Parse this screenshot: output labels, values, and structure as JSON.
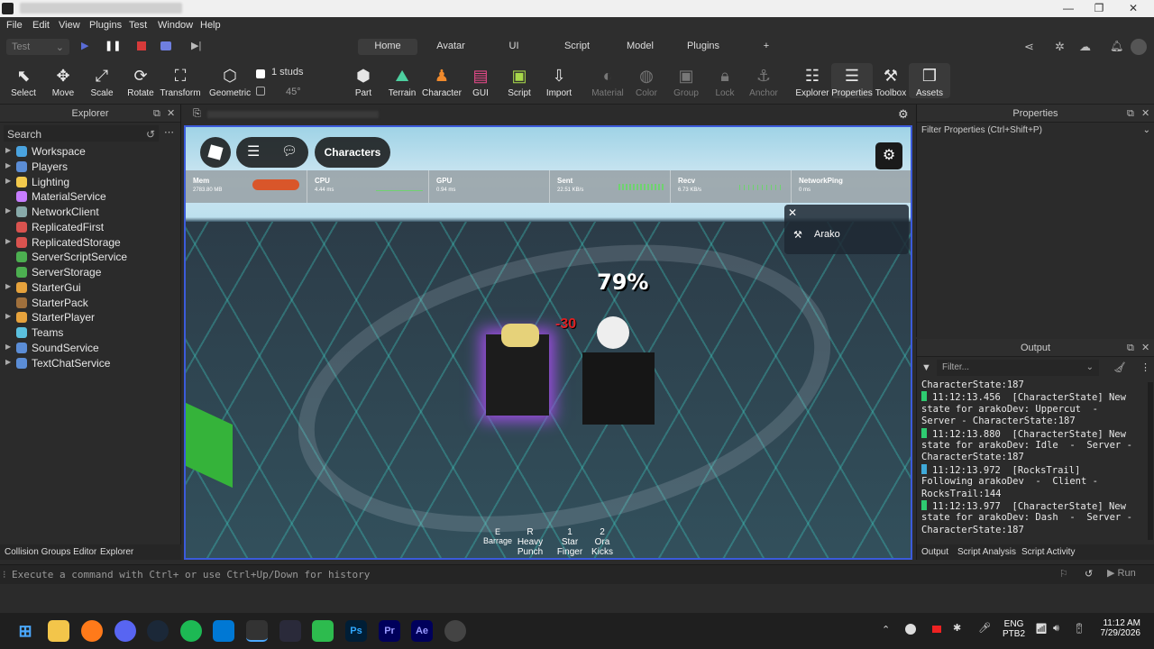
{
  "menu": [
    "File",
    "Edit",
    "View",
    "Plugins",
    "Test",
    "Window",
    "Help"
  ],
  "toolbar": {
    "mode": "Test",
    "ribbon_tabs": [
      "Home",
      "Avatar",
      "UI",
      "Script",
      "Model",
      "Plugins",
      "+"
    ],
    "studs": "1 studs",
    "angle": "45°"
  },
  "tools": [
    {
      "label": "Select",
      "icon": "cursor-icon"
    },
    {
      "label": "Move",
      "icon": "move-icon"
    },
    {
      "label": "Scale",
      "icon": "scale-icon"
    },
    {
      "label": "Rotate",
      "icon": "rotate-icon"
    },
    {
      "label": "Transform",
      "icon": "transform-icon"
    },
    {
      "label": "Geometric",
      "icon": "geometric-icon"
    },
    {
      "label": "Part",
      "icon": "part-icon"
    },
    {
      "label": "Terrain",
      "icon": "terrain-icon"
    },
    {
      "label": "Character",
      "icon": "character-icon"
    },
    {
      "label": "GUI",
      "icon": "gui-icon"
    },
    {
      "label": "Script",
      "icon": "script-icon"
    },
    {
      "label": "Import",
      "icon": "import-icon"
    },
    {
      "label": "Material",
      "icon": "material-icon"
    },
    {
      "label": "Color",
      "icon": "color-icon"
    },
    {
      "label": "Group",
      "icon": "group-icon"
    },
    {
      "label": "Lock",
      "icon": "lock-icon"
    },
    {
      "label": "Anchor",
      "icon": "anchor-icon"
    },
    {
      "label": "Explorer",
      "icon": "explorer-icon"
    },
    {
      "label": "Properties",
      "icon": "properties-icon"
    },
    {
      "label": "Toolbox",
      "icon": "toolbox-icon"
    },
    {
      "label": "Assets",
      "icon": "assets-icon"
    }
  ],
  "explorer": {
    "title": "Explorer",
    "search_placeholder": "Search",
    "items": [
      {
        "label": "Workspace",
        "color": "#4aa3df",
        "expand": true
      },
      {
        "label": "Players",
        "color": "#5b8dd6",
        "expand": true
      },
      {
        "label": "Lighting",
        "color": "#f2c94c",
        "expand": true
      },
      {
        "label": "MaterialService",
        "color": "#c77dff",
        "expand": false
      },
      {
        "label": "NetworkClient",
        "color": "#8aa",
        "expand": true
      },
      {
        "label": "ReplicatedFirst",
        "color": "#d9534f",
        "expand": false
      },
      {
        "label": "ReplicatedStorage",
        "color": "#d9534f",
        "expand": true
      },
      {
        "label": "ServerScriptService",
        "color": "#4caf50",
        "expand": false
      },
      {
        "label": "ServerStorage",
        "color": "#4caf50",
        "expand": false
      },
      {
        "label": "StarterGui",
        "color": "#e6a23c",
        "expand": true
      },
      {
        "label": "StarterPack",
        "color": "#a0703c",
        "expand": false
      },
      {
        "label": "StarterPlayer",
        "color": "#e6a23c",
        "expand": true
      },
      {
        "label": "Teams",
        "color": "#5bc0de",
        "expand": false
      },
      {
        "label": "SoundService",
        "color": "#5b8dd6",
        "expand": true
      },
      {
        "label": "TextChatService",
        "color": "#5b8dd6",
        "expand": true
      }
    ],
    "bottom_tabs": [
      "Collision Groups Editor",
      "Explorer"
    ]
  },
  "game": {
    "characters_button": "Characters",
    "stats": [
      {
        "name": "Mem",
        "val": "2783.80 MB"
      },
      {
        "name": "CPU",
        "val": "4.44 ms"
      },
      {
        "name": "GPU",
        "val": "0.94 ms"
      },
      {
        "name": "Sent",
        "val": "22.51 KB/s"
      },
      {
        "name": "Recv",
        "val": "6.73 KB/s"
      },
      {
        "name": "NetworkPing",
        "val": "0 ms"
      }
    ],
    "player": "Arako",
    "percent": "79%",
    "damage": "-30",
    "skills": [
      {
        "key": "E",
        "name": "Barrage"
      },
      {
        "key": "R",
        "name": "Heavy Punch"
      },
      {
        "key": "1",
        "name": "Star Finger"
      },
      {
        "key": "2",
        "name": "Ora Kicks"
      }
    ]
  },
  "properties": {
    "title": "Properties",
    "filter": "Filter Properties (Ctrl+Shift+P)"
  },
  "output": {
    "title": "Output",
    "filter_placeholder": "Filter...",
    "lines": [
      {
        "c": "",
        "t": "CharacterState:187"
      },
      {
        "c": "#2ecc71",
        "t": "11:12:13.456  [CharacterState] New"
      },
      {
        "c": "",
        "t": "state for arakoDev: Uppercut  -"
      },
      {
        "c": "",
        "t": "Server - CharacterState:187"
      },
      {
        "c": "#2ecc71",
        "t": "11:12:13.880  [CharacterState] New"
      },
      {
        "c": "",
        "t": "state for arakoDev: Idle  -  Server -"
      },
      {
        "c": "",
        "t": "CharacterState:187"
      },
      {
        "c": "#3fa9d8",
        "t": "11:12:13.972  [RocksTrail]"
      },
      {
        "c": "",
        "t": "Following arakoDev  -  Client -"
      },
      {
        "c": "",
        "t": "RocksTrail:144"
      },
      {
        "c": "#2ecc71",
        "t": "11:12:13.977  [CharacterState] New"
      },
      {
        "c": "",
        "t": "state for arakoDev: Dash  -  Server -"
      },
      {
        "c": "",
        "t": "CharacterState:187"
      }
    ],
    "tabs": [
      "Output",
      "Script Analysis",
      "Script Activity"
    ]
  },
  "command": {
    "placeholder": "Execute a command with Ctrl+ or use Ctrl+Up/Down for history",
    "run": "Run"
  },
  "taskbar": {
    "lang": "ENG",
    "layout": "PTB2",
    "time": "11:12 AM",
    "date": "7/29/2026"
  }
}
